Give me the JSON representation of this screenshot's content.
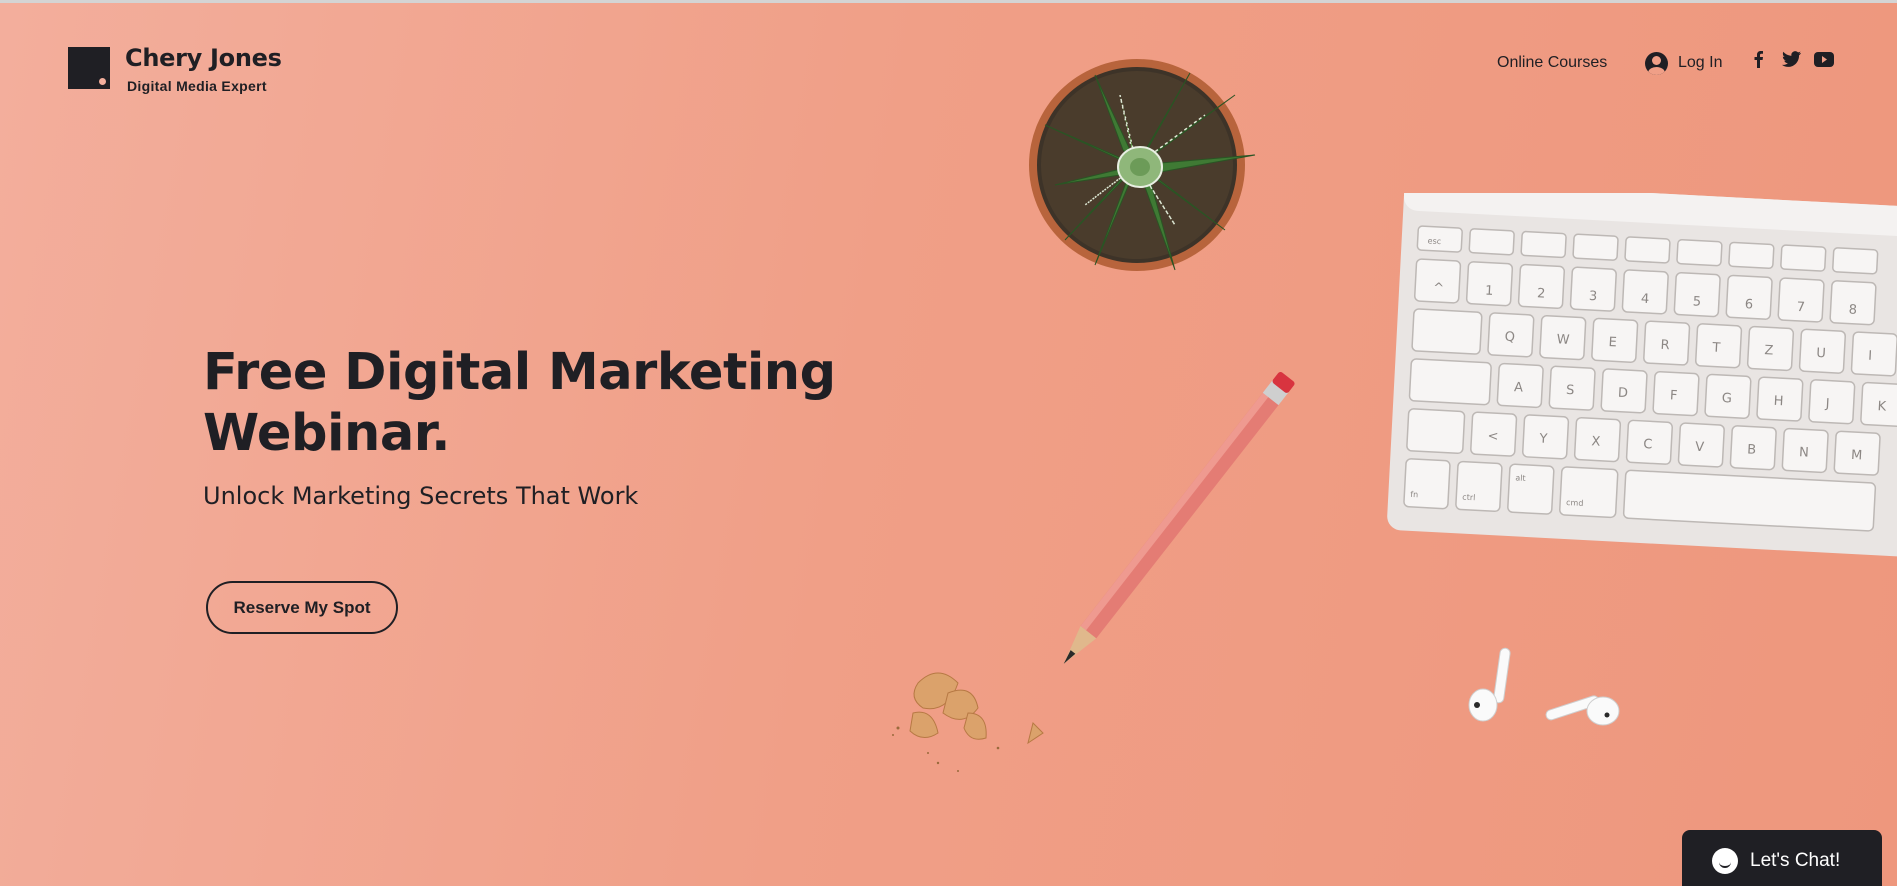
{
  "brand": {
    "name": "Chery Jones",
    "tagline": "Digital Media Expert"
  },
  "nav": {
    "online_courses": "Online Courses",
    "login": "Log In",
    "social_icons": [
      "facebook-icon",
      "twitter-icon",
      "youtube-icon"
    ]
  },
  "hero": {
    "headline": "Free Digital Marketing Webinar.",
    "subheadline": "Unlock Marketing Secrets That Work",
    "cta_label": "Reserve My Spot"
  },
  "chat": {
    "label": "Let's Chat!"
  },
  "keyboard_keys": {
    "row0": [
      "esc"
    ],
    "row1": [
      "^",
      "1",
      "2",
      "3",
      "4",
      "5",
      "6",
      "7",
      "8"
    ],
    "row2": [
      "Q",
      "W",
      "E",
      "R",
      "T",
      "Z",
      "U",
      "I"
    ],
    "row3": [
      "A",
      "S",
      "D",
      "F",
      "G",
      "H",
      "J",
      "K"
    ],
    "row4": [
      "<",
      "Y",
      "X",
      "C",
      "V",
      "B",
      "N",
      "M"
    ],
    "row5": [
      "fn",
      "ctrl",
      "alt",
      "cmd"
    ]
  },
  "colors": {
    "background": "#f09f87",
    "text": "#1f1f24",
    "chat_bg": "#1f1f24"
  }
}
